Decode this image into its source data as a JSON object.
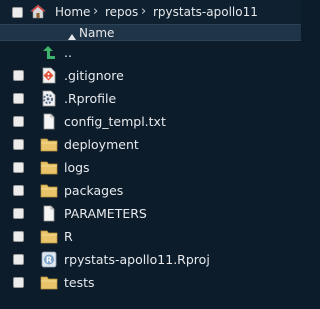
{
  "breadcrumb": {
    "home_label": "Home",
    "separator": "›",
    "items": [
      "repos",
      "rpystats-apollo11"
    ]
  },
  "columns": {
    "name_label": "Name",
    "sort_icon": "sort-up-icon"
  },
  "files": [
    {
      "name": "..",
      "icon": "parent-dir-icon",
      "has_checkbox": false
    },
    {
      "name": ".gitignore",
      "icon": "gitignore-file-icon",
      "has_checkbox": true
    },
    {
      "name": ".Rprofile",
      "icon": "r-profile-file-icon",
      "has_checkbox": true
    },
    {
      "name": "config_templ.txt",
      "icon": "text-file-icon",
      "has_checkbox": true
    },
    {
      "name": "deployment",
      "icon": "folder-icon",
      "has_checkbox": true
    },
    {
      "name": "logs",
      "icon": "folder-icon",
      "has_checkbox": true
    },
    {
      "name": "packages",
      "icon": "folder-icon",
      "has_checkbox": true
    },
    {
      "name": "PARAMETERS",
      "icon": "text-file-icon",
      "has_checkbox": true
    },
    {
      "name": "R",
      "icon": "folder-icon",
      "has_checkbox": true
    },
    {
      "name": "rpystats-apollo11.Rproj",
      "icon": "rproj-file-icon",
      "has_checkbox": true
    },
    {
      "name": "tests",
      "icon": "folder-icon",
      "has_checkbox": true
    }
  ],
  "colors": {
    "background": "#0c1c2b",
    "header": "#1f3447",
    "folder": "#e9c46a",
    "parent_arrow": "#3db36b"
  }
}
